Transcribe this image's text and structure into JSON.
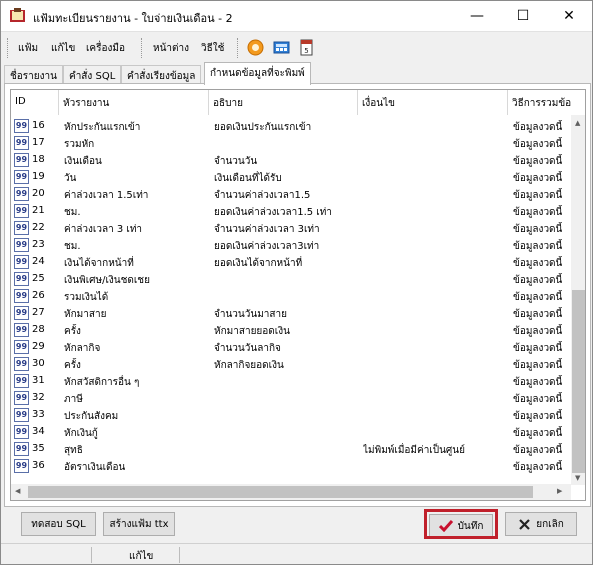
{
  "window": {
    "title": "แฟ้มทะเบียนรายงาน - ใบจ่ายเงินเดือน - 2",
    "minimize": "—",
    "maximize": "☐",
    "close": "✕"
  },
  "menu": {
    "file": "แฟ้ม",
    "edit": "แก้ไข",
    "tools": "เครื่องมือ",
    "window": "หน้าต่าง",
    "help": "วิธีใช้"
  },
  "tabs": [
    "ชื่อรายงาน",
    "คำสั่ง SQL",
    "คำสั่งเรียงข้อมูล",
    "กำหนดข้อมูลที่จะพิมพ์"
  ],
  "grid": {
    "headers": [
      "ID",
      "หัวรายงาน",
      "อธิบาย",
      "เงื่อนไข",
      "วิธีการรวมข้อ"
    ],
    "rows": [
      {
        "id": "16",
        "title": "หักประกันแรกเข้า",
        "desc": "ยอดเงินประกันแรกเข้า",
        "cond": "",
        "method": "ข้อมูลงวดนี้"
      },
      {
        "id": "17",
        "title": "รวมหัก",
        "desc": "",
        "cond": "",
        "method": "ข้อมูลงวดนี้"
      },
      {
        "id": "18",
        "title": "เงินเดือน",
        "desc": "จำนวนวัน",
        "cond": "",
        "method": "ข้อมูลงวดนี้"
      },
      {
        "id": "19",
        "title": "วัน",
        "desc": "เงินเดือนที่ได้รับ",
        "cond": "",
        "method": "ข้อมูลงวดนี้"
      },
      {
        "id": "20",
        "title": "ค่าล่วงเวลา 1.5เท่า",
        "desc": "จำนวนค่าล่วงเวลา1.5",
        "cond": "",
        "method": "ข้อมูลงวดนี้"
      },
      {
        "id": "21",
        "title": "ชม.",
        "desc": "ยอดเงินค่าล่วงเวลา1.5 เท่า",
        "cond": "",
        "method": "ข้อมูลงวดนี้"
      },
      {
        "id": "22",
        "title": "ค่าล่วงเวลา 3 เท่า",
        "desc": "จำนวนค่าล่วงเวลา 3เท่า",
        "cond": "",
        "method": "ข้อมูลงวดนี้"
      },
      {
        "id": "23",
        "title": "ชม.",
        "desc": "ยอดเงินค่าล่วงเวลา3เท่า",
        "cond": "",
        "method": "ข้อมูลงวดนี้"
      },
      {
        "id": "24",
        "title": "เงินได้จากหน้าที่",
        "desc": "ยอดเงินได้จากหน้าที่",
        "cond": "",
        "method": "ข้อมูลงวดนี้"
      },
      {
        "id": "25",
        "title": "เงินพิเศษ/เงินชดเชย",
        "desc": "",
        "cond": "",
        "method": "ข้อมูลงวดนี้"
      },
      {
        "id": "26",
        "title": "รวมเงินได้",
        "desc": "",
        "cond": "",
        "method": "ข้อมูลงวดนี้"
      },
      {
        "id": "27",
        "title": "หักมาสาย",
        "desc": "จำนวนวันมาสาย",
        "cond": "",
        "method": "ข้อมูลงวดนี้"
      },
      {
        "id": "28",
        "title": "ครั้ง",
        "desc": "หักมาสายยอดเงิน",
        "cond": "",
        "method": "ข้อมูลงวดนี้"
      },
      {
        "id": "29",
        "title": "หักลากิจ",
        "desc": "จำนวนวันลากิจ",
        "cond": "",
        "method": "ข้อมูลงวดนี้"
      },
      {
        "id": "30",
        "title": "ครั้ง",
        "desc": "หักลากิจยอดเงิน",
        "cond": "",
        "method": "ข้อมูลงวดนี้"
      },
      {
        "id": "31",
        "title": "หักสวัสดิการอื่น ๆ",
        "desc": "",
        "cond": "",
        "method": "ข้อมูลงวดนี้"
      },
      {
        "id": "32",
        "title": "ภาษี",
        "desc": "",
        "cond": "",
        "method": "ข้อมูลงวดนี้"
      },
      {
        "id": "33",
        "title": "ประกันสังคม",
        "desc": "",
        "cond": "",
        "method": "ข้อมูลงวดนี้"
      },
      {
        "id": "34",
        "title": "หักเงินกู้",
        "desc": "",
        "cond": "",
        "method": "ข้อมูลงวดนี้"
      },
      {
        "id": "35",
        "title": "สุทธิ",
        "desc": "",
        "cond": "ไม่พิมพ์เมื่อมีค่าเป็นศูนย์",
        "method": "ข้อมูลงวดนี้"
      },
      {
        "id": "36",
        "title": "อัตราเงินเดือน",
        "desc": "",
        "cond": "",
        "method": "ข้อมูลงวดนี้"
      }
    ],
    "row_icon_text": "99"
  },
  "buttons": {
    "test_sql": "ทดสอบ SQL",
    "create_ttx": "สร้างแฟ้ม ttx",
    "save": "บันทึก",
    "cancel": "ยกเลิก"
  },
  "status": {
    "mode": "แก้ไข"
  },
  "colors": {
    "highlight": "#c0202b",
    "save_check": "#c8102e",
    "cancel_x": "#222222"
  }
}
